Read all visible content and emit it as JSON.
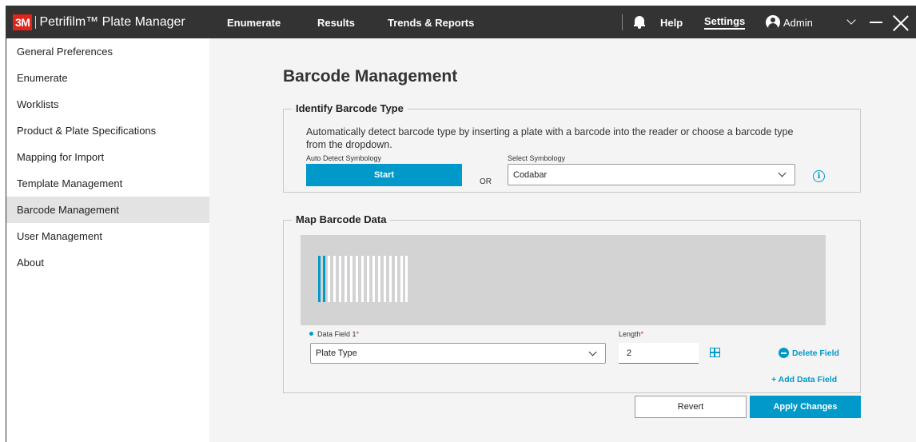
{
  "app": {
    "logo_text": "3M",
    "title": "Petrifilm™ Plate Manager"
  },
  "topnav": {
    "enumerate": "Enumerate",
    "results": "Results",
    "trends": "Trends & Reports",
    "help": "Help",
    "settings": "Settings",
    "user": "Admin"
  },
  "sidebar": {
    "items": [
      {
        "label": "General Preferences"
      },
      {
        "label": "Enumerate"
      },
      {
        "label": "Worklists"
      },
      {
        "label": "Product & Plate Specifications"
      },
      {
        "label": "Mapping for Import"
      },
      {
        "label": "Template Management"
      },
      {
        "label": "Barcode Management",
        "active": true
      },
      {
        "label": "User Management"
      },
      {
        "label": "About"
      }
    ]
  },
  "page": {
    "title": "Barcode Management"
  },
  "identify": {
    "legend": "Identify Barcode Type",
    "description": "Automatically detect barcode type by inserting a plate with a barcode into the reader or choose a barcode type from the dropdown.",
    "auto_label": "Auto Detect Symbology",
    "start_label": "Start",
    "or_label": "OR",
    "select_label": "Select Symbology",
    "select_value": "Codabar",
    "info_glyph": "i"
  },
  "map": {
    "legend": "Map Barcode Data",
    "field_label": "Data Field 1",
    "required_mark": "*",
    "field_value": "Plate Type",
    "length_label": "Length",
    "length_value": "2",
    "delete_label": "Delete Field",
    "add_label": "+ Add Data Field"
  },
  "actions": {
    "revert": "Revert",
    "apply": "Apply Changes"
  },
  "colors": {
    "accent": "#0099c9",
    "topbar": "#333333",
    "brand_red": "#e2231a"
  },
  "icons": [
    "bell-icon",
    "user-circle-icon",
    "chevron-down-icon",
    "minimize-icon",
    "close-icon",
    "info-icon",
    "grid-icon",
    "minus-circle-icon"
  ]
}
